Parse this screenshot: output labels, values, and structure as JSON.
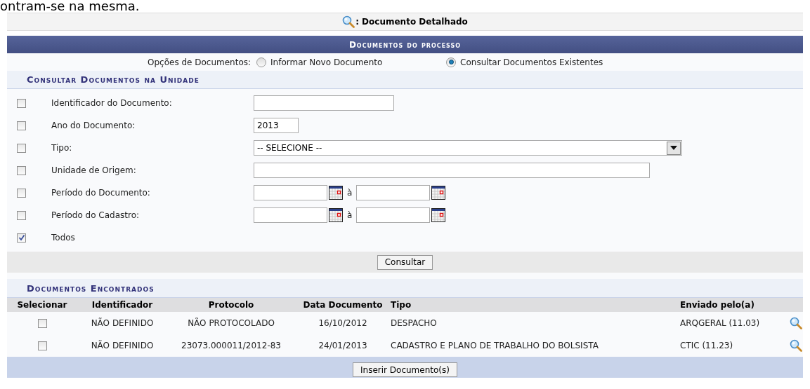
{
  "intro_text": "ontram-se na mesma.",
  "page_title": ": Documento Detalhado",
  "panel_title": "Documentos do processo",
  "options": {
    "label": "Opções de Documentos:",
    "items": [
      {
        "label": "Informar Novo Documento",
        "selected": false
      },
      {
        "label": "Consultar Documentos Existentes",
        "selected": true
      }
    ]
  },
  "search": {
    "title": "Consultar Documentos na Unidade",
    "filters": [
      {
        "kind": "text",
        "label": "Identificador do Documento:",
        "checked": false
      },
      {
        "kind": "text",
        "label": "Ano do Documento:",
        "checked": false,
        "value": "2013"
      },
      {
        "kind": "select",
        "label": "Tipo:",
        "checked": false,
        "value": "-- SELECIONE --"
      },
      {
        "kind": "text",
        "label": "Unidade de Origem:",
        "checked": false
      },
      {
        "kind": "range",
        "label": "Período do Documento:",
        "checked": false,
        "separator": "à"
      },
      {
        "kind": "range",
        "label": "Período do Cadastro:",
        "checked": false,
        "separator": "à"
      },
      {
        "kind": "plain",
        "label": "Todos",
        "checked": true
      }
    ],
    "button": "Consultar"
  },
  "results": {
    "title": "Documentos Encontrados",
    "select_column": "Selecionar",
    "columns": [
      "Identificador",
      "Protocolo",
      "Data Documento",
      "Tipo",
      "Enviado pelo(a)"
    ],
    "rows": [
      {
        "selected": false,
        "cells": [
          "NÃO DEFINIDO",
          "NÃO PROTOCOLADO",
          "16/10/2012",
          "DESPACHO",
          "ARQGERAL (11.03)"
        ]
      },
      {
        "selected": false,
        "cells": [
          "NÃO DEFINIDO",
          "23073.000011/2012-83",
          "24/01/2013",
          "CADASTRO E PLANO DE TRABALHO DO BOLSISTA",
          "CTIC (11.23)"
        ]
      }
    ],
    "button": "Inserir Documento(s)"
  }
}
